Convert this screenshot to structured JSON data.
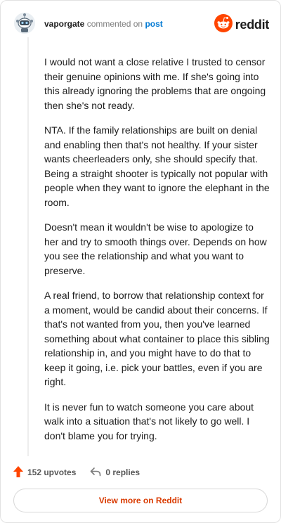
{
  "comment": {
    "author": "vaporgate",
    "action_text": "commented on",
    "target_link": "post",
    "paragraphs": [
      "I would not want a close relative I trusted to censor their genuine opinions with me. If she's going into this already ignoring the problems that are ongoing then she's not ready.",
      "NTA. If the family relationships are built on denial and enabling then that's not healthy. If your sister wants cheerleaders only, she should specify that. Being a straight shooter is typically not popular with people when they want to ignore the elephant in the room.",
      "Doesn't mean it wouldn't be wise to apologize to her and try to smooth things over. Depends on how you see the relationship and what you want to preserve.",
      "A real friend, to borrow that relationship context for a moment, would be candid about their concerns. If that's not wanted from you, then you've learned something about what container to place this sibling relationship in, and you might have to do that to keep it going, i.e. pick your battles, even if you are right.",
      "It is never fun to watch someone you care about walk into a situation that's not likely to go well. I don't blame you for trying."
    ]
  },
  "brand": {
    "wordmark": "reddit",
    "color": "#ff4500"
  },
  "actions": {
    "upvotes_label": "152 upvotes",
    "replies_label": "0 replies"
  },
  "footer": {
    "view_more_label": "View more on Reddit"
  },
  "icons": {
    "avatar": "snoo-avatar-icon",
    "brand": "reddit-logo-icon",
    "upvote": "upvote-arrow-icon",
    "reply": "reply-arrow-icon"
  }
}
